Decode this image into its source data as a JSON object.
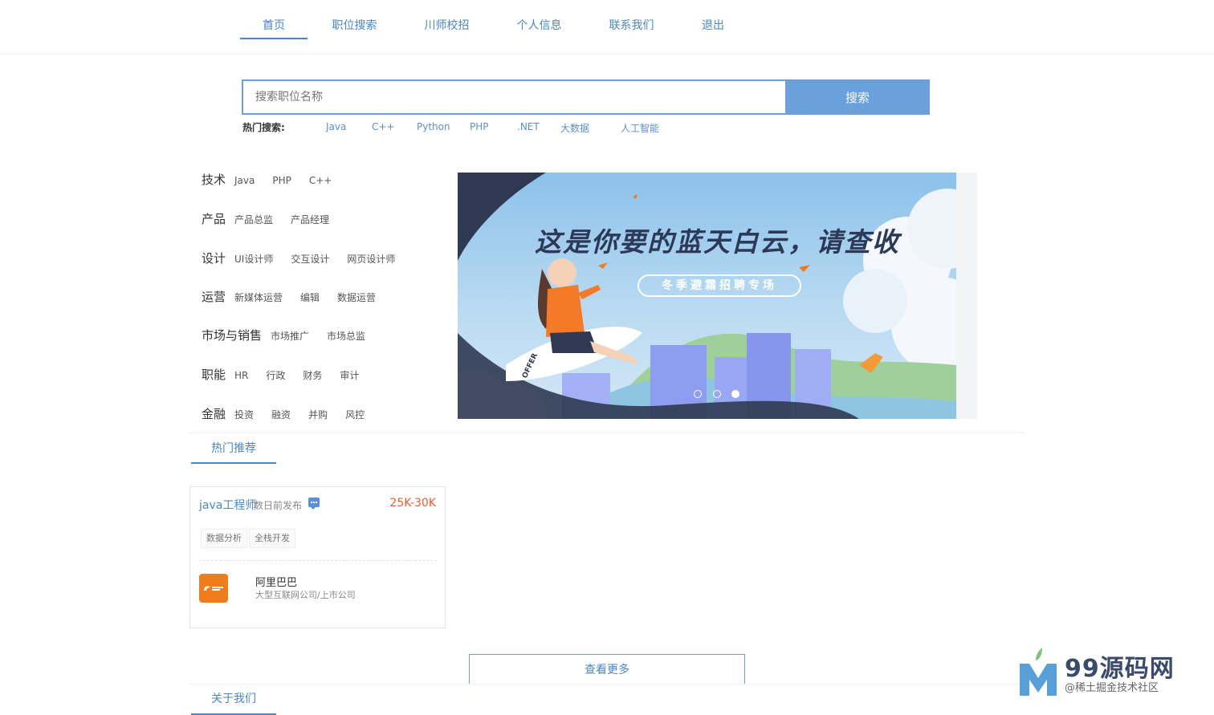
{
  "nav": {
    "items": [
      {
        "label": "首页",
        "active": true
      },
      {
        "label": "职位搜索",
        "active": false
      },
      {
        "label": "川师校招",
        "active": false
      },
      {
        "label": "个人信息",
        "active": false
      },
      {
        "label": "联系我们",
        "active": false
      },
      {
        "label": "退出",
        "active": false
      }
    ]
  },
  "search": {
    "placeholder": "搜索职位名称",
    "value": "",
    "button_label": "搜索",
    "hot_label": "热门搜索:",
    "hot_keywords": [
      "Java",
      "C++",
      "Python",
      "PHP",
      ".NET",
      "大数据",
      "人工智能"
    ]
  },
  "categories": [
    {
      "title": "技术",
      "items": [
        "Java",
        "PHP",
        "C++"
      ]
    },
    {
      "title": "产品",
      "items": [
        "产品总监",
        "产品经理"
      ]
    },
    {
      "title": "设计",
      "items": [
        "UI设计师",
        "交互设计",
        "网页设计师"
      ]
    },
    {
      "title": "运营",
      "items": [
        "新媒体运营",
        "编辑",
        "数据运营"
      ]
    },
    {
      "title": "市场与销售",
      "items": [
        "市场推广",
        "市场总监"
      ]
    },
    {
      "title": "职能",
      "items": [
        "HR",
        "行政",
        "财务",
        "审计"
      ]
    },
    {
      "title": "金融",
      "items": [
        "投资",
        "融资",
        "并购",
        "风控"
      ]
    }
  ],
  "banner": {
    "title": "这是你要的蓝天白云，请查收",
    "subtitle": "冬季避霜招聘专场",
    "paper_text": "OFFER",
    "slide_count": 3,
    "active_slide": 3
  },
  "hot": {
    "tab_label": "热门推荐"
  },
  "job": {
    "title": "java工程师",
    "date": "数日前发布",
    "salary": "25K-30K",
    "tags": [
      "数据分析",
      "全栈开发"
    ],
    "company": "阿里巴巴",
    "company_desc": "大型互联网公司/上市公司"
  },
  "more_label": "查看更多",
  "about": {
    "tab_label": "关于我们"
  },
  "watermark": {
    "text": "99源码网",
    "sub": "@稀土掘金技术社区"
  },
  "colors": {
    "accent": "#4a86c8",
    "search_button": "#6aa1dd",
    "salary": "#f05b2e",
    "company_logo": "#f07c1c"
  }
}
